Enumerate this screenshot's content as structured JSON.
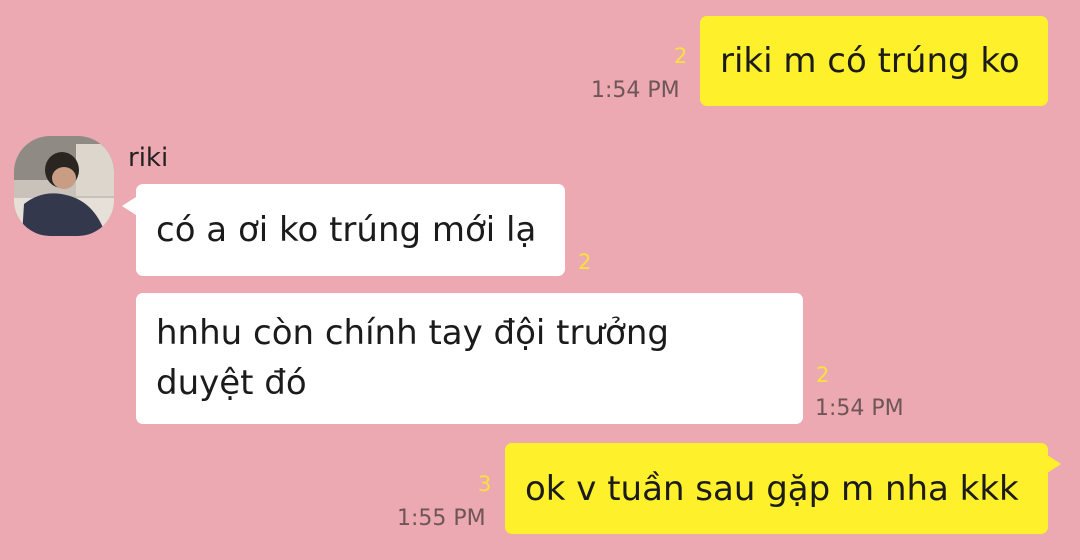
{
  "messages": [
    {
      "text": "riki m có trúng ko",
      "unread": "2",
      "time": "1:54 PM"
    },
    {
      "text": "có a ơi ko trúng mới lạ",
      "unread": "2"
    },
    {
      "text_line1": "hnhu còn chính tay đội trưởng",
      "text_line2": "duyệt đó",
      "unread": "2",
      "time": "1:54 PM"
    },
    {
      "text": "ok v tuần sau gặp m nha kkk",
      "unread": "3",
      "time": "1:55 PM"
    }
  ],
  "contact": {
    "name": "riki",
    "avatar_icon": "profile-photo"
  },
  "colors": {
    "background": "#eda9b1",
    "outgoing_bubble": "#fff02c",
    "incoming_bubble": "#ffffff",
    "unread_count": "#f6e23a",
    "timestamp": "#6d5558"
  }
}
